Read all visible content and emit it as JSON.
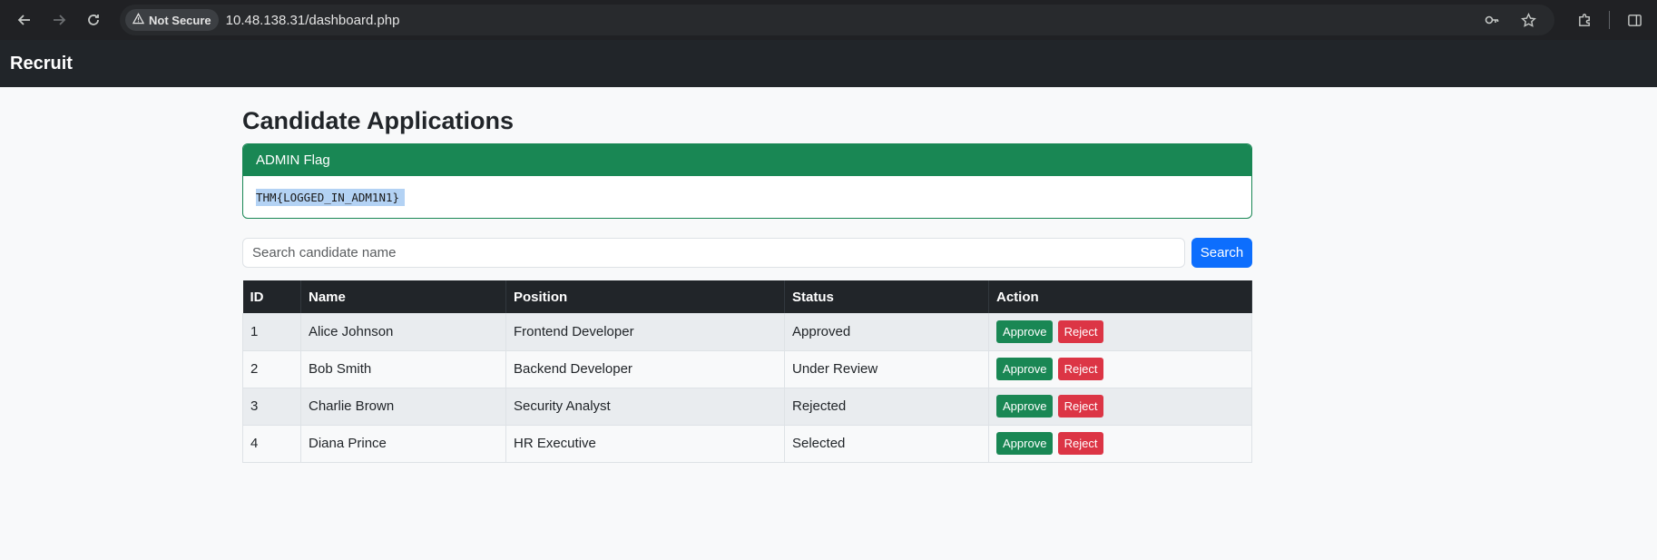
{
  "browser": {
    "security_label": "Not Secure",
    "url": "10.48.138.31/dashboard.php"
  },
  "site": {
    "brand": "Recruit"
  },
  "page": {
    "title": "Candidate Applications"
  },
  "flag_card": {
    "header": "ADMIN Flag",
    "value": "THM{LOGGED_IN_ADM1N1}"
  },
  "search": {
    "placeholder": "Search candidate name",
    "value": "",
    "button_label": "Search"
  },
  "table": {
    "headers": [
      "ID",
      "Name",
      "Position",
      "Status",
      "Action"
    ],
    "rows": [
      {
        "id": "1",
        "name": "Alice Johnson",
        "position": "Frontend Developer",
        "status": "Approved",
        "approve_label": "Approve",
        "reject_label": "Reject"
      },
      {
        "id": "2",
        "name": "Bob Smith",
        "position": "Backend Developer",
        "status": "Under Review",
        "approve_label": "Approve",
        "reject_label": "Reject"
      },
      {
        "id": "3",
        "name": "Charlie Brown",
        "position": "Security Analyst",
        "status": "Rejected",
        "approve_label": "Approve",
        "reject_label": "Reject"
      },
      {
        "id": "4",
        "name": "Diana Prince",
        "position": "HR Executive",
        "status": "Selected",
        "approve_label": "Approve",
        "reject_label": "Reject"
      }
    ]
  },
  "colors": {
    "success": "#198754",
    "danger": "#dc3545",
    "primary": "#0d6efd",
    "dark": "#212529"
  }
}
